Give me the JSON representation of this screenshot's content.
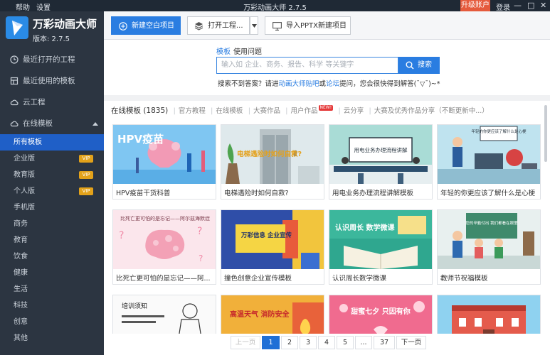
{
  "titlebar": {
    "menu": [
      "帮助",
      "设置"
    ],
    "title": "万彩动画大师 2.7.5",
    "upgrade": "升级账户",
    "login": "登录",
    "win": [
      "—",
      "□",
      "✕"
    ]
  },
  "brand": {
    "name": "万彩动画大师",
    "version": "版本: 2.7.5"
  },
  "nav": [
    {
      "label": "最近打开的工程",
      "icon": "clock-icon"
    },
    {
      "label": "最近使用的模板",
      "icon": "template-icon"
    },
    {
      "label": "云工程",
      "icon": "cloud-icon"
    },
    {
      "label": "在线模板",
      "icon": "cloud-icon"
    }
  ],
  "sub_nav": [
    {
      "label": "所有模板",
      "vip": ""
    },
    {
      "label": "企业版",
      "vip": "VIP"
    },
    {
      "label": "教育版",
      "vip": "VIP"
    },
    {
      "label": "个人版",
      "vip": "VIP"
    },
    {
      "label": "手机版",
      "vip": ""
    },
    {
      "label": "商务",
      "vip": ""
    },
    {
      "label": "教育",
      "vip": ""
    },
    {
      "label": "饮食",
      "vip": ""
    },
    {
      "label": "健康",
      "vip": ""
    },
    {
      "label": "生活",
      "vip": ""
    },
    {
      "label": "科技",
      "vip": ""
    },
    {
      "label": "创意",
      "vip": ""
    },
    {
      "label": "其他",
      "vip": ""
    }
  ],
  "toolbar": {
    "new_blank": "新建空白项目",
    "open_project": "打开工程...",
    "import_pptx": "导入PPTX新建项目"
  },
  "search": {
    "tab_template": "模板",
    "tab_question": "使用问题",
    "placeholder": "输入如 企业、商务、报告、科学 等关键字",
    "button": "搜索",
    "hint_a": "搜索不到答案？请进",
    "hint_link1": "动画大师贴吧",
    "hint_or": "或",
    "hint_link2": "论坛",
    "hint_b": "提问，您会很快得到解答(¯▽¯)~*"
  },
  "section": {
    "title": "在线模板 (1835)",
    "tabs": [
      "官方教程",
      "在线模板",
      "大赛作品",
      "用户作品",
      "云分享",
      "大赛及优秀作品分享（不断更新中...）"
    ],
    "new_badge": "NEW!"
  },
  "cards": [
    {
      "title": "HPV疫苗干货科普",
      "thumb_text": "HPV疫苗"
    },
    {
      "title": "电梯遇险时如何自救?",
      "thumb_text": "电梯遇险时如何自救?"
    },
    {
      "title": "用电业务办理流程讲解模板",
      "thumb_text": "用电业务办理流程讲解"
    },
    {
      "title": "年轻的你更应该了解什么是心梗",
      "thumb_text": "年轻的你更应该了解什么是心梗"
    },
    {
      "title": "比死亡更可怕的是忘记——阿...",
      "thumb_text": "比死亡更可怕的是忘记——阿尔兹海默症"
    },
    {
      "title": "撞色创意企业宣传模板",
      "thumb_text": "万彩信息 企业宣传"
    },
    {
      "title": "认识周长数学微课",
      "thumb_text": "认识周长 数学微课"
    },
    {
      "title": "教师节祝福模板",
      "thumb_text": "您的辛勤付出 我们都看在眼里"
    },
    {
      "title": "",
      "thumb_text": "培训须知"
    },
    {
      "title": "",
      "thumb_text": "高温天气 消防安全"
    },
    {
      "title": "",
      "thumb_text": "甜蜜七夕 只因有你"
    },
    {
      "title": "",
      "thumb_text": ""
    }
  ],
  "pager": {
    "prev": "上一页",
    "pages": [
      "1",
      "2",
      "3",
      "4",
      "5",
      "...",
      "37"
    ],
    "next": "下一页",
    "current": "1"
  },
  "colors": {
    "accent": "#2a7de1",
    "sidebar": "#2c3541",
    "active_nav": "#1f5fc7",
    "vip": "#e3a21a",
    "upgrade": "#e55a3c"
  }
}
